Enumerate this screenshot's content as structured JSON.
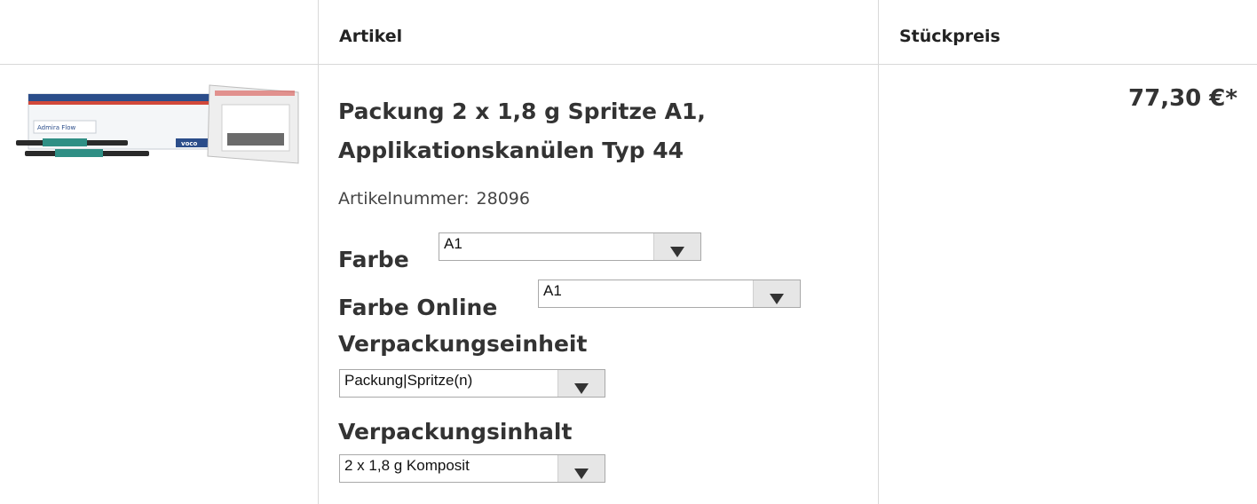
{
  "table": {
    "headers": {
      "artikel": "Artikel",
      "stueckpreis": "Stückpreis"
    }
  },
  "product": {
    "image_alt": "Admira Flow",
    "image_brand": "voco",
    "title": "Packung 2 x 1,8 g Spritze A1, Applikationskanülen Typ 44",
    "article_number_label": "Artikelnummer:",
    "article_number": "28096",
    "price": "77,30 €*"
  },
  "options": {
    "farbe": {
      "label": "Farbe",
      "value": "A1"
    },
    "farbe_online": {
      "label": "Farbe Online",
      "value": "A1"
    },
    "verpackungseinheit": {
      "label": "Verpackungseinheit",
      "value": "Packung|Spritze(n)"
    },
    "verpackungsinhalt": {
      "label": "Verpackungsinhalt",
      "value": "2 x 1,8 g Komposit"
    }
  },
  "colors": {
    "border": "#d9d9d9",
    "text": "#333333",
    "select_button": "#e6e6e6"
  }
}
